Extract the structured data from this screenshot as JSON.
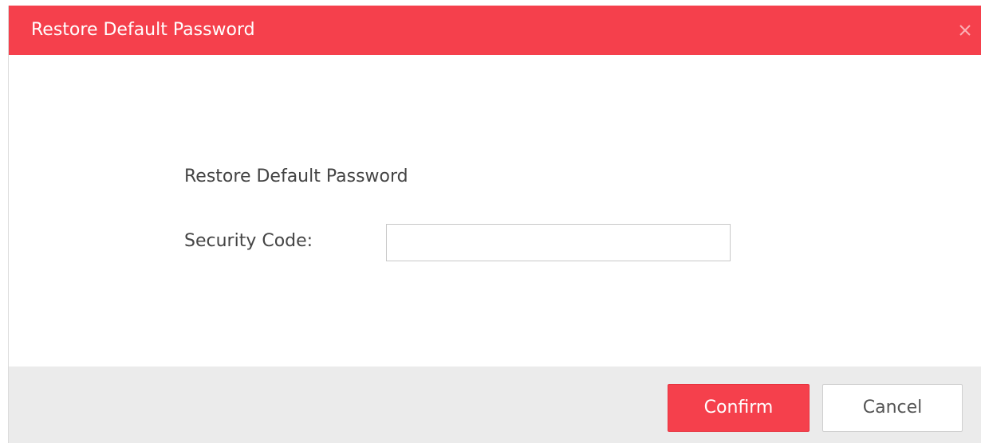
{
  "dialog": {
    "title": "Restore Default Password",
    "close_icon": "close-icon",
    "accent_color": "#f5404c"
  },
  "form": {
    "heading": "Restore Default Password",
    "security_code_label": "Security Code:",
    "security_code_value": "",
    "security_code_placeholder": ""
  },
  "footer": {
    "confirm_label": "Confirm",
    "cancel_label": "Cancel"
  }
}
